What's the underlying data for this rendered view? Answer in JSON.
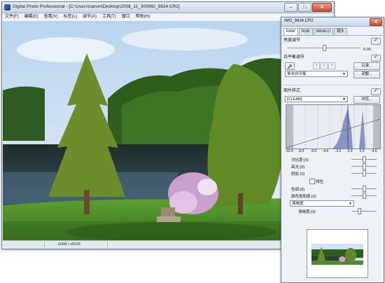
{
  "window": {
    "title": "Digital Photo Professional - [C:\\Users\\canon\\Desktop\\2008_11_30\\IMG_9834.CR2]",
    "minimize_icon": "minimize-icon",
    "maximize_icon": "maximize-icon",
    "close_icon": "close-icon",
    "buttons": {
      "minimize": "–",
      "maximize": "□",
      "close": "✕"
    }
  },
  "menu": [
    "文件(F)",
    "编辑(E)",
    "查看(V)",
    "标签(L)",
    "调节(A)",
    "工具(T)",
    "窗口",
    "帮助(H)"
  ],
  "status": {
    "text": "RAW / sRGB"
  },
  "palette": {
    "title": "IMG_9834.CR2",
    "close_glyph": "✕",
    "tabs": [
      "RAW",
      "RGB",
      "NR/ALO",
      "镜头"
    ],
    "active_tab": "RAW",
    "brightness": {
      "label": "亮度调节",
      "value": "0.00",
      "level": 0.5
    },
    "reset_glyph": "↶",
    "white_balance": {
      "label": "白平衡调节",
      "eyedropper_icon": "eyedropper-icon",
      "presets": [
        "1",
        "2",
        "3"
      ],
      "register_label": "记录...",
      "mode_value": "单击白平衡",
      "adjust_label": "调整...",
      "arrow": "▼"
    },
    "picture_style": {
      "label": "图片样式",
      "value": "[CLEAR]",
      "browse_label": "浏览...",
      "arrow": "▼"
    },
    "histogram_ticks": [
      "-10.0",
      "-8.0",
      "-6.0",
      "-4.0",
      "-2.0",
      "0.0",
      "2.0",
      "4.0"
    ],
    "contrast": {
      "label": "对比度:(0)",
      "level": 0.5
    },
    "highlight": {
      "label": "高光:(0)",
      "level": 0.5
    },
    "shadow": {
      "label": "阴影:(0)",
      "level": 0.5
    },
    "linear_label": "线性",
    "color_tone": {
      "label": "色调:(0)",
      "level": 0.5
    },
    "saturation": {
      "label": "颜色饱和度:(0)",
      "level": 0.5
    },
    "clarity_select": "清晰度",
    "clarity": {
      "label": "清晰度:(3)",
      "level": 0.3
    }
  },
  "colors": {
    "accent": "#3d6fb7",
    "grass": "#4f8a2c",
    "sky": "#cfe3f5",
    "water": "#2d3c3a",
    "flowers": "#d9a7d6"
  }
}
